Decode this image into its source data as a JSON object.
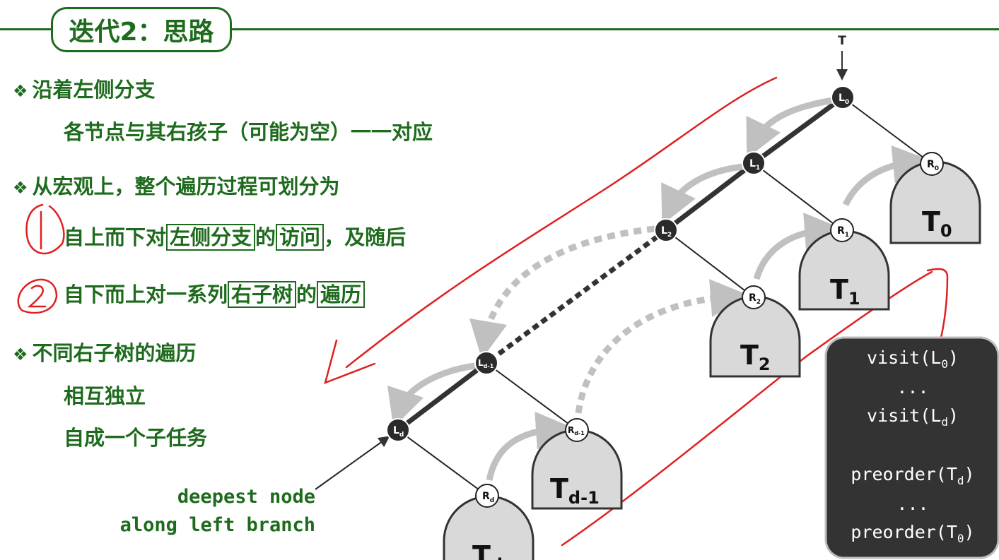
{
  "title": "迭代2：思路",
  "bullets": {
    "b1": "沿着左侧分支",
    "b1_sub": "各节点与其右孩子（可能为空）一一对应",
    "b2": "从宏观上，整个遍历过程可划分为",
    "s1_pre": "自上而下对",
    "s1_box1": "左侧分支",
    "s1_mid": "的",
    "s1_box2": "访问",
    "s1_post": "，及随后",
    "s2_pre": "自下而上对一系列",
    "s2_box1": "右子树",
    "s2_mid": "的",
    "s2_box2": "遍历",
    "b3": "不同右子树的遍历",
    "b3_sub1": "相互独立",
    "b3_sub2": "自成一个子任务"
  },
  "annotation": {
    "line1": "deepest node",
    "line2": "along left branch"
  },
  "tree": {
    "root_label": "T",
    "left_nodes": [
      "L",
      "L",
      "L",
      "L",
      "L"
    ],
    "left_subs": [
      "0",
      "1",
      "2",
      "d-1",
      "d"
    ],
    "right_nodes": [
      "R",
      "R",
      "R",
      "R",
      "R"
    ],
    "right_subs": [
      "0",
      "1",
      "2",
      "d-1",
      "d"
    ],
    "subtrees": [
      "T",
      "T",
      "T",
      "T",
      "T"
    ],
    "subtree_subs": [
      "0",
      "1",
      "2",
      "d-1",
      "d"
    ]
  },
  "code": {
    "l1_a": "visit(L",
    "l1_sub": "0",
    "l1_b": ")",
    "l2": "...",
    "l3_a": "visit(L",
    "l3_sub": "d",
    "l3_b": ")",
    "l4_a": "preorder(T",
    "l4_sub": "d",
    "l4_b": ")",
    "l5": "...",
    "l6_a": "preorder(T",
    "l6_sub": "0",
    "l6_b": ")"
  },
  "colors": {
    "green": "#1e6b1e",
    "red": "#e02020",
    "gray_arrow": "#c0c0c0",
    "node_dark": "#2b2b2b",
    "subtree_fill": "#d9d9d9",
    "code_bg": "#333333"
  }
}
